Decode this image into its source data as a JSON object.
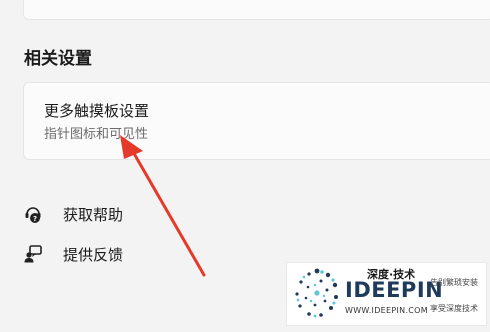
{
  "section": {
    "title": "相关设置"
  },
  "related_setting": {
    "title": "更多触摸板设置",
    "description": "指针图标和可见性"
  },
  "links": [
    {
      "label": "获取帮助",
      "icon": "get-help-icon"
    },
    {
      "label": "提供反馈",
      "icon": "feedback-icon"
    }
  ],
  "annotation": {
    "arrow_color": "#e53a2a"
  },
  "watermark": {
    "top_text": "深度·技术",
    "brand": "IDEEPIN",
    "url": "WWW.IDEEPIN.COM",
    "slogan_line1": "告别繁琐安装",
    "slogan_line2": "享受深度技术",
    "brand_color": "#1f3b5c",
    "accent_color": "#5cc8d6"
  }
}
